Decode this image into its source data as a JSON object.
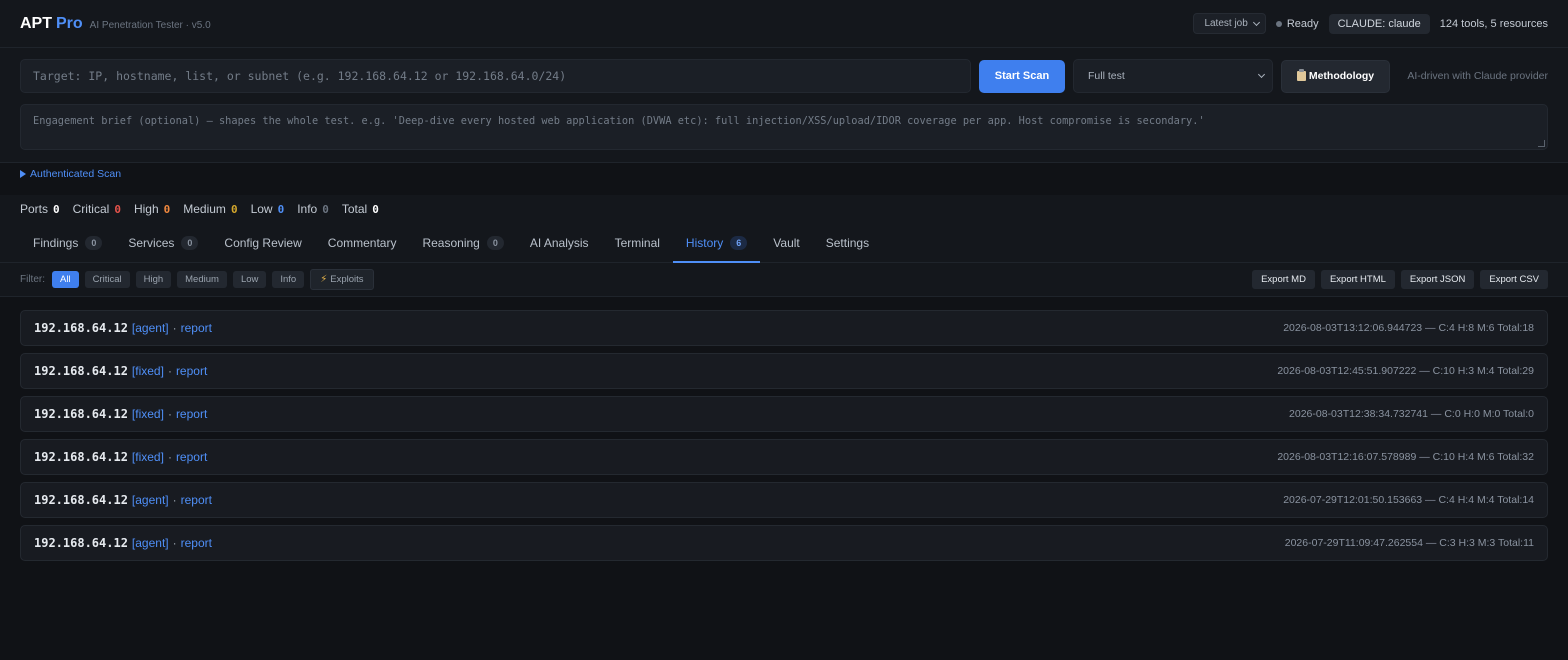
{
  "header": {
    "brand_main": "APT",
    "brand_accent": "Pro",
    "subtitle": "AI Penetration Tester · v5.0",
    "job_select": "Latest job",
    "status": "Ready",
    "provider_badge": "CLAUDE: claude",
    "tools_count": "124 tools, 5 resources"
  },
  "scan": {
    "target_placeholder": "Target: IP, hostname, list, or subnet (e.g. 192.168.64.12 or 192.168.64.0/24)",
    "start_label": "Start Scan",
    "mode_value": "Full test",
    "methodology_label": "Methodology",
    "ai_note": "AI-driven with Claude provider",
    "brief_placeholder": "Engagement brief (optional) — shapes the whole test. e.g. 'Deep-dive every hosted web application (DVWA etc): full injection/XSS/upload/IDOR coverage per app. Host compromise is secondary.'",
    "auth_label": "Authenticated Scan"
  },
  "counts": [
    {
      "label": "Ports",
      "value": "0",
      "color": "#ffffff"
    },
    {
      "label": "Critical",
      "value": "0",
      "color": "#e5534b"
    },
    {
      "label": "High",
      "value": "0",
      "color": "#f0883e"
    },
    {
      "label": "Medium",
      "value": "0",
      "color": "#d4a72c"
    },
    {
      "label": "Low",
      "value": "0",
      "color": "#4f8ff7"
    },
    {
      "label": "Info",
      "value": "0",
      "color": "#6b7480"
    },
    {
      "label": "Total",
      "value": "0",
      "color": "#ffffff"
    }
  ],
  "tabs": [
    {
      "label": "Findings",
      "badge": "0"
    },
    {
      "label": "Services",
      "badge": "0"
    },
    {
      "label": "Config Review"
    },
    {
      "label": "Commentary"
    },
    {
      "label": "Reasoning",
      "badge": "0"
    },
    {
      "label": "AI Analysis"
    },
    {
      "label": "Terminal"
    },
    {
      "label": "History",
      "badge": "6",
      "active": true
    },
    {
      "label": "Vault"
    },
    {
      "label": "Settings"
    }
  ],
  "filter": {
    "label": "Filter:",
    "buttons": [
      "All",
      "Critical",
      "High",
      "Medium",
      "Low",
      "Info"
    ],
    "exploits_label": "Exploits",
    "exports": [
      "Export MD",
      "Export HTML",
      "Export JSON",
      "Export CSV"
    ]
  },
  "history": [
    {
      "ip": "192.168.64.12",
      "tag": "[agent]",
      "link": "report",
      "meta": "2026-08-03T13:12:06.944723 — C:4 H:8 M:6 Total:18"
    },
    {
      "ip": "192.168.64.12",
      "tag": "[fixed]",
      "link": "report",
      "meta": "2026-08-03T12:45:51.907222 — C:10 H:3 M:4 Total:29"
    },
    {
      "ip": "192.168.64.12",
      "tag": "[fixed]",
      "link": "report",
      "meta": "2026-08-03T12:38:34.732741 — C:0 H:0 M:0 Total:0"
    },
    {
      "ip": "192.168.64.12",
      "tag": "[fixed]",
      "link": "report",
      "meta": "2026-08-03T12:16:07.578989 — C:10 H:4 M:6 Total:32"
    },
    {
      "ip": "192.168.64.12",
      "tag": "[agent]",
      "link": "report",
      "meta": "2026-07-29T12:01:50.153663 — C:4 H:4 M:4 Total:14"
    },
    {
      "ip": "192.168.64.12",
      "tag": "[agent]",
      "link": "report",
      "meta": "2026-07-29T11:09:47.262554 — C:3 H:3 M:3 Total:11"
    }
  ]
}
